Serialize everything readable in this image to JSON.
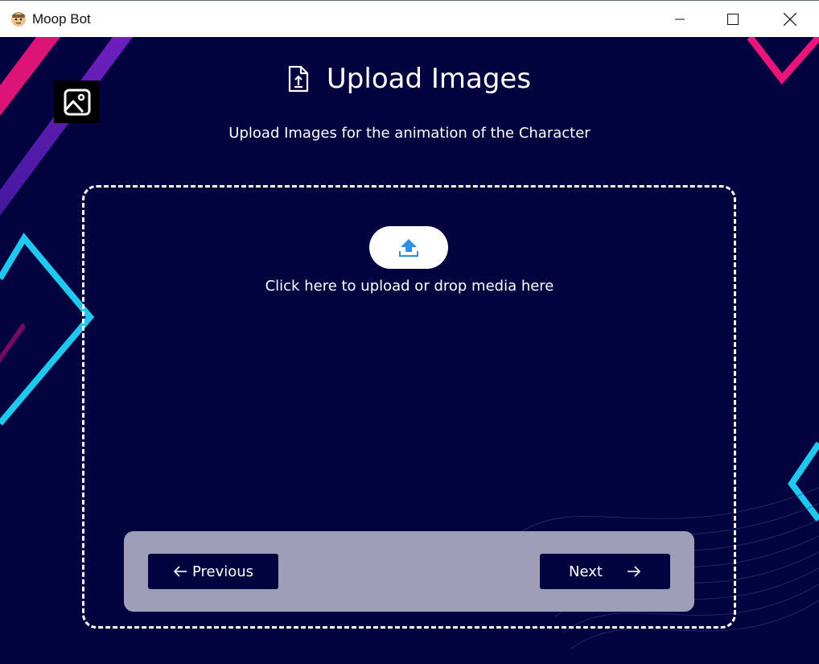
{
  "window": {
    "title": "Moop Bot"
  },
  "header": {
    "title": "Upload Images",
    "subtitle": "Upload Images for the animation of the Character"
  },
  "dropzone": {
    "prompt": "Click here to upload or drop media here"
  },
  "navigation": {
    "previous_label": "Previous",
    "next_label": "Next"
  },
  "icons": {
    "app": "bot-face-icon",
    "image": "image-icon",
    "file_upload": "file-upload-icon",
    "upload": "upload-arrow-icon",
    "arrow_left": "arrow-left-icon",
    "arrow_right": "arrow-right-icon"
  },
  "colors": {
    "background": "#03033f",
    "panel": "#9e9eb8",
    "accent_blue": "#2f8fe6",
    "deco_pink": "#e8157a",
    "deco_purple": "#6a1fc2",
    "deco_cyan": "#1ec8ee"
  }
}
